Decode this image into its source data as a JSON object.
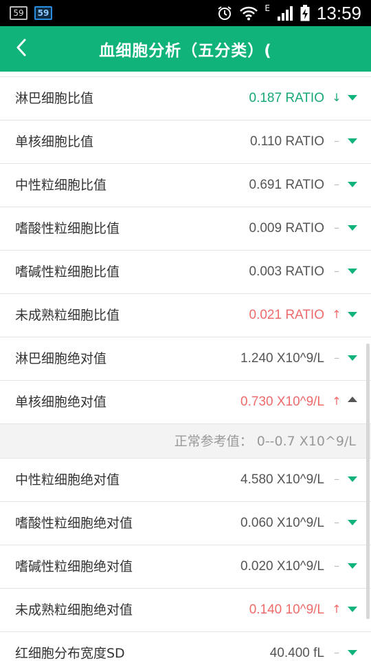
{
  "status_bar": {
    "badge_1": "59",
    "badge_2": "59",
    "network_letter": "E",
    "time": "13:59"
  },
  "header": {
    "title": "血细胞分析（五分类）("
  },
  "rows": [
    {
      "name": "淋巴细胞比值",
      "value": "0.187 RATIO",
      "flag": "↓",
      "status": "low",
      "expanded": false
    },
    {
      "name": "单核细胞比值",
      "value": "0.110 RATIO",
      "flag": "–",
      "status": "normal",
      "expanded": false
    },
    {
      "name": "中性粒细胞比值",
      "value": "0.691 RATIO",
      "flag": "–",
      "status": "normal",
      "expanded": false
    },
    {
      "name": "嗜酸性粒细胞比值",
      "value": "0.009 RATIO",
      "flag": "–",
      "status": "normal",
      "expanded": false
    },
    {
      "name": "嗜碱性粒细胞比值",
      "value": "0.003 RATIO",
      "flag": "–",
      "status": "normal",
      "expanded": false
    },
    {
      "name": "未成熟粒细胞比值",
      "value": "0.021 RATIO",
      "flag": "↑",
      "status": "high",
      "expanded": false
    },
    {
      "name": "淋巴细胞绝对值",
      "value": "1.240 X10^9/L",
      "flag": "–",
      "status": "normal",
      "expanded": false
    },
    {
      "name": "单核细胞绝对值",
      "value": "0.730 X10^9/L",
      "flag": "↑",
      "status": "high",
      "expanded": true,
      "reference": "正常参考值： 0--0.7 X10^9/L"
    },
    {
      "name": "中性粒细胞绝对值",
      "value": "4.580 X10^9/L",
      "flag": "–",
      "status": "normal",
      "expanded": false
    },
    {
      "name": "嗜酸性粒细胞绝对值",
      "value": "0.060 X10^9/L",
      "flag": "–",
      "status": "normal",
      "expanded": false
    },
    {
      "name": "嗜碱性粒细胞绝对值",
      "value": "0.020 X10^9/L",
      "flag": "–",
      "status": "normal",
      "expanded": false
    },
    {
      "name": "未成熟粒细胞绝对值",
      "value": "0.140 10^9/L",
      "flag": "↑",
      "status": "high",
      "expanded": false
    },
    {
      "name": "红细胞分布宽度SD",
      "value": "40.400 fL",
      "flag": "–",
      "status": "normal",
      "expanded": false
    }
  ],
  "colors": {
    "accent": "#10b37a",
    "low": "#16a777",
    "high": "#ef6a6a"
  },
  "icons": {
    "back": "chevron-left-icon",
    "expand": "caret-down-icon",
    "collapse": "caret-up-icon"
  }
}
